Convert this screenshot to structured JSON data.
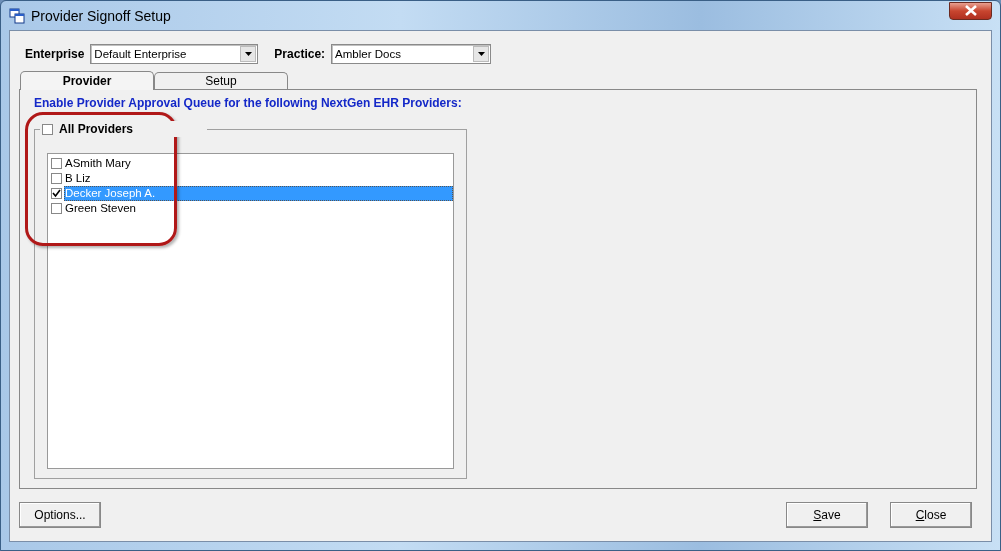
{
  "window": {
    "title": "Provider Signoff Setup"
  },
  "filters": [
    {
      "label": "Enterprise",
      "value": "Default Enterprise"
    },
    {
      "label": "Practice:",
      "value": "Ambler Docs"
    }
  ],
  "tabs": [
    {
      "label": "Provider",
      "selected": true
    },
    {
      "label": "Setup",
      "selected": false
    }
  ],
  "heading": "Enable Provider Approval Queue for the following NextGen EHR Providers:",
  "all_providers": {
    "label": "All Providers",
    "checked": false
  },
  "providers": [
    {
      "name": "ASmith Mary",
      "checked": false,
      "selected": false
    },
    {
      "name": "B Liz",
      "checked": false,
      "selected": false
    },
    {
      "name": "Decker Joseph A.",
      "checked": true,
      "selected": true
    },
    {
      "name": "Green Steven",
      "checked": false,
      "selected": false
    }
  ],
  "buttons": [
    {
      "label": "Options...",
      "mnemonic": false
    },
    {
      "label": "Save",
      "mnemonic": true
    },
    {
      "label": "Close",
      "mnemonic": true
    }
  ]
}
